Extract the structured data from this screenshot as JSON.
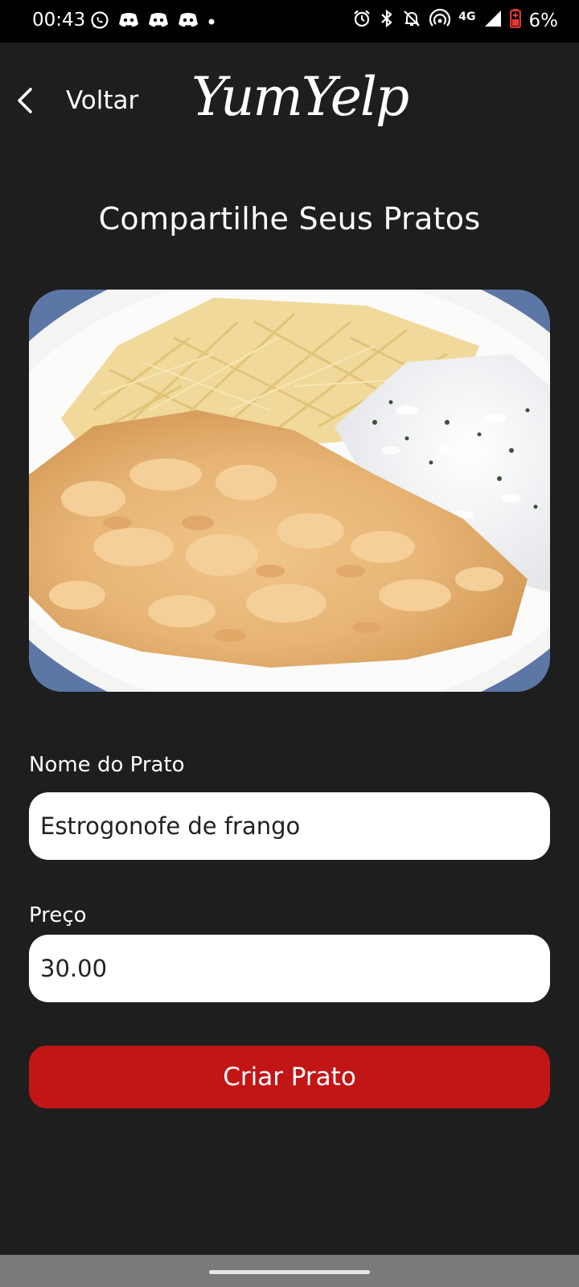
{
  "status_bar": {
    "time": "00:43",
    "network": "4G",
    "battery": "6%",
    "left_icons": [
      "whatsapp-icon",
      "discord-icon",
      "discord-icon",
      "discord-icon",
      "dot-icon"
    ],
    "right_icons": [
      "alarm-icon",
      "bluetooth-icon",
      "bell-off-icon",
      "hotspot-icon",
      "signal-icon",
      "battery-icon"
    ]
  },
  "header": {
    "back_label": "Voltar",
    "logo_text": "YumYelp"
  },
  "page": {
    "title": "Compartilhe Seus Pratos"
  },
  "form": {
    "name_label": "Nome do Prato",
    "name_value": "Estrogonofe de frango",
    "price_label": "Preço",
    "price_value": "30.00",
    "submit_label": "Criar Prato"
  },
  "colors": {
    "background": "#1f1e1e",
    "accent": "#c21616",
    "input_bg": "#ffffff"
  }
}
